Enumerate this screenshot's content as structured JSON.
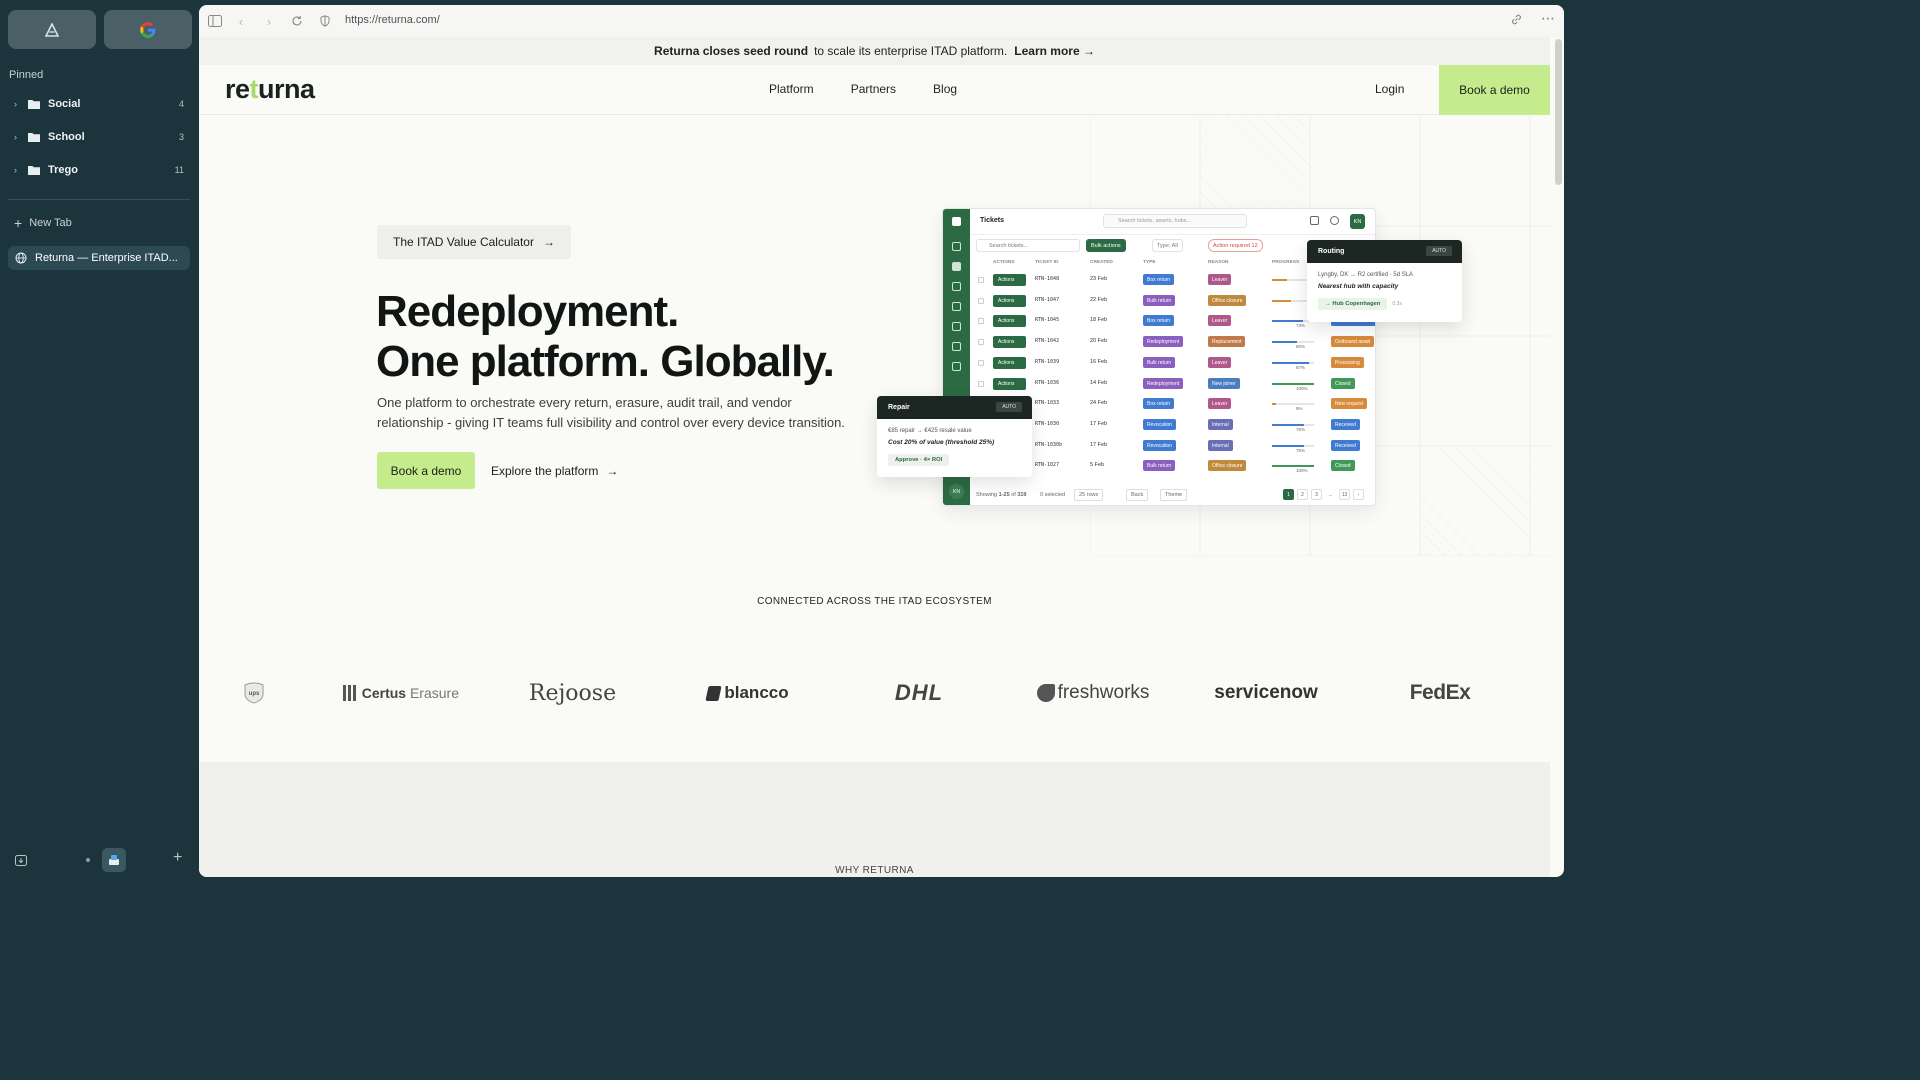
{
  "sidebar": {
    "pinned_label": "Pinned",
    "folders": [
      {
        "name": "Social",
        "count": "4"
      },
      {
        "name": "School",
        "count": "3"
      },
      {
        "name": "Trego",
        "count": "11"
      }
    ],
    "new_tab": "New Tab",
    "active_tab": "Returna — Enterprise ITAD..."
  },
  "browser": {
    "url": "https://returna.com/"
  },
  "banner": {
    "bold": "Returna closes seed round",
    "text": "to scale its enterprise ITAD platform.",
    "link": "Learn more →"
  },
  "nav": {
    "logo_pre": "re",
    "logo_accent": "t",
    "logo_post": "urna",
    "links": [
      "Platform",
      "Partners",
      "Blog"
    ],
    "login": "Login",
    "demo": "Book a demo"
  },
  "hero": {
    "calc_label": "The ITAD Value Calculator",
    "title_line1": "Redeployment.",
    "title_line2": "One platform. Globally.",
    "subtitle": "One platform to orchestrate every return, erasure, audit trail, and vendor relationship - giving IT teams full visibility and control over every device transition.",
    "cta_primary": "Book a demo",
    "cta_secondary": "Explore the platform"
  },
  "mock": {
    "title": "Tickets",
    "search": "Search tickets, assets, hubs...",
    "avatar": "KN",
    "filter_search": "Search tickets...",
    "bulk": "Bulk actions",
    "type_filter": "Type: All",
    "action_required": "Action required 12",
    "columns": [
      "ACTIONS",
      "TICKET ID",
      "CREATED",
      "TYPE",
      "REASON",
      "PROGRESS"
    ],
    "action_label": "Actions",
    "rows": [
      {
        "id": "RTN-1048",
        "created": "23 Feb",
        "type": "Box return",
        "reason": "Leaver",
        "pct": "",
        "progress": 0.35,
        "status": ""
      },
      {
        "id": "RTN-1047",
        "created": "22 Feb",
        "type": "Bulk return",
        "reason": "Office closure",
        "pct": "",
        "progress": 0.45,
        "status": ""
      },
      {
        "id": "RTN-1045",
        "created": "18 Feb",
        "type": "Box return",
        "reason": "Leaver",
        "pct": "73%",
        "progress": 0.73,
        "status": "Inbound received"
      },
      {
        "id": "RTN-1042",
        "created": "20 Feb",
        "type": "Redeployment",
        "reason": "Replacement",
        "pct": "60%",
        "progress": 0.6,
        "status": "Outbound await"
      },
      {
        "id": "RTN-1039",
        "created": "16 Feb",
        "type": "Bulk return",
        "reason": "Leaver",
        "pct": "87%",
        "progress": 0.87,
        "status": "Processing"
      },
      {
        "id": "RTN-1036",
        "created": "14 Feb",
        "type": "Redeployment",
        "reason": "New joiner",
        "pct": "100%",
        "progress": 1.0,
        "status": "Closed"
      },
      {
        "id": "RTN-1033",
        "created": "24 Feb",
        "type": "Box return",
        "reason": "Leaver",
        "pct": "9%",
        "progress": 0.09,
        "status": "New request"
      },
      {
        "id": "RTN-1030",
        "created": "17 Feb",
        "type": "Revocation",
        "reason": "Internal",
        "pct": "75%",
        "progress": 0.75,
        "status": "Received"
      },
      {
        "id": "RTN-1030b",
        "created": "17 Feb",
        "type": "Revocation",
        "reason": "Internal",
        "pct": "75%",
        "progress": 0.75,
        "status": "Received"
      },
      {
        "id": "RTN-1027",
        "created": "5 Feb",
        "type": "Bulk return",
        "reason": "Office closure",
        "pct": "100%",
        "progress": 1.0,
        "status": "Closed"
      }
    ],
    "footer_showing": "Showing",
    "footer_range": "1-25",
    "footer_of": "of",
    "footer_total": "319",
    "footer_selected": "0 selected",
    "footer_rows": "25 rows",
    "footer_back": "Back",
    "footer_theme": "Theme",
    "pages": [
      "1",
      "2",
      "3",
      "...",
      "13",
      "›"
    ]
  },
  "routing_card": {
    "title": "Routing",
    "badge": "AUTO",
    "line1": "Lyngby, DK → R2 certified · 5d SLA",
    "line2": "Nearest hub with capacity",
    "chip": "→ Hub Copenhagen",
    "time": "0.3s"
  },
  "repair_card": {
    "title": "Repair",
    "badge": "AUTO",
    "line1": "€85 repair → €425 resale value",
    "line2": "Cost 20% of value (threshold 25%)",
    "chip": "Approve · 4× ROI"
  },
  "ecosystem": {
    "label": "CONNECTED ACROSS THE ITAD ECOSYSTEM",
    "logos": [
      "ups",
      "Certus",
      "Erasure",
      "Rejoose",
      "blancco",
      "DHL",
      "freshworks",
      "servicenow",
      "FedEx"
    ]
  },
  "why_label": "WHY RETURNA",
  "colors": {
    "accent": "#c4ec8c",
    "brand_green": "#2c6a43",
    "sidebar": "#1c343c"
  }
}
